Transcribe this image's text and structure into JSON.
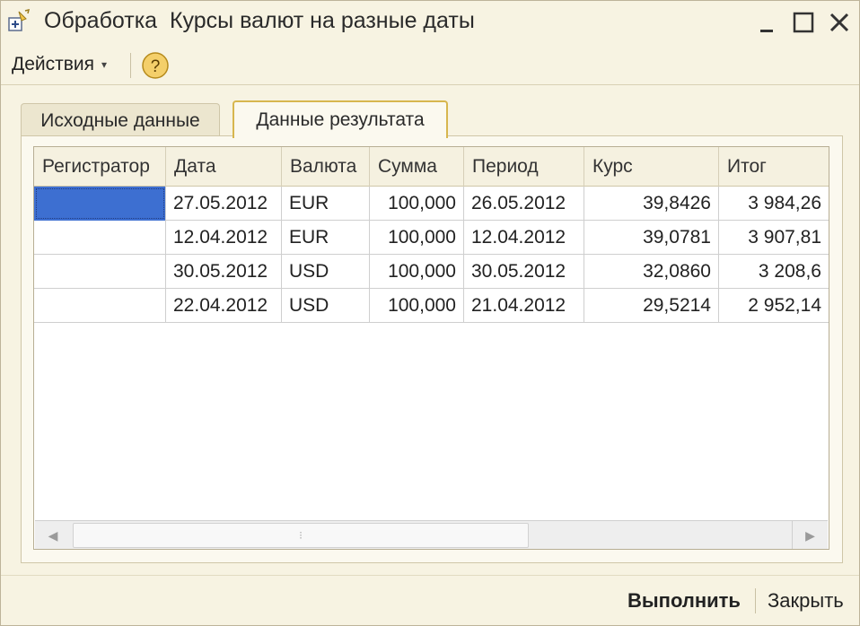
{
  "window": {
    "title": "Обработка  Курсы валют на разные даты",
    "icons": [
      "processing-icon",
      "minimize-icon",
      "maximize-icon",
      "close-icon"
    ]
  },
  "toolbar": {
    "actions_label": "Действия",
    "actions_caret": "▾",
    "help_label": "?"
  },
  "tabs": [
    {
      "label": "Исходные данные",
      "active": false
    },
    {
      "label": "Данные результата",
      "active": true
    }
  ],
  "grid": {
    "columns": [
      "Регистратор",
      "Дата",
      "Валюта",
      "Сумма",
      "Период",
      "Курс",
      "Итог"
    ],
    "rows": [
      {
        "registrator": "",
        "date": "27.05.2012",
        "currency": "EUR",
        "sum": "100,000",
        "period": "26.05.2012",
        "rate": "39,8426",
        "total": "3 984,26"
      },
      {
        "registrator": "",
        "date": "12.04.2012",
        "currency": "EUR",
        "sum": "100,000",
        "period": "12.04.2012",
        "rate": "39,0781",
        "total": "3 907,81"
      },
      {
        "registrator": "",
        "date": "30.05.2012",
        "currency": "USD",
        "sum": "100,000",
        "period": "30.05.2012",
        "rate": "32,0860",
        "total": "3 208,6"
      },
      {
        "registrator": "",
        "date": "22.04.2012",
        "currency": "USD",
        "sum": "100,000",
        "period": "21.04.2012",
        "rate": "29,5214",
        "total": "2 952,14"
      }
    ],
    "selected_color": "#3d6fd1"
  },
  "scrollbar": {
    "left_arrow": "◀",
    "right_arrow": "▶",
    "thumb_grip": "⁝"
  },
  "footer": {
    "run_label": "Выполнить",
    "close_label": "Закрыть"
  },
  "colors": {
    "window_bg": "#f7f3e2",
    "active_tab_border": "#d7b64e",
    "help_button": "#f1c04a"
  }
}
